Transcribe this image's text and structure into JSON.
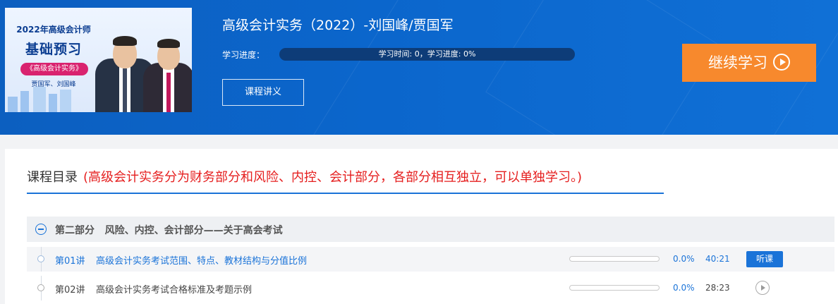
{
  "course": {
    "title": "高级会计实务（2022）-刘国峰/贾国军",
    "thumbnail": {
      "year_label": "2022年高级会计师",
      "headline": "基础预习",
      "pill": "《高级会计实务》",
      "teachers": "贾国军、刘国峰"
    },
    "progress_label": "学习进度：",
    "progress_text": "学习时间: 0，学习进度: 0%",
    "progress_fraction": 0,
    "handout_button": "课程讲义",
    "continue_button": "继续学习"
  },
  "catalog": {
    "title": "课程目录",
    "note": "(高级会计实务分为财务部分和风险、内控、会计部分，各部分相互独立，可以单独学习。)"
  },
  "section": {
    "title": "第二部分   风险、内控、会计部分——关于高会考试"
  },
  "lessons": [
    {
      "number": "第01讲",
      "name": "高级会计实务考试范围、特点、教材结构与分值比例",
      "progress_fraction": 0,
      "percent": "0.0%",
      "duration": "40:21",
      "action": "听课"
    },
    {
      "number": "第02讲",
      "name": "高级会计实务考试合格标准及考题示例",
      "progress_fraction": 0,
      "percent": "0.0%",
      "duration": "28:23",
      "action": ""
    }
  ],
  "colors": {
    "banner": "#0b66cc",
    "accent": "#1a73d8",
    "continue": "#f7892d",
    "note_red": "#e51e1e"
  }
}
